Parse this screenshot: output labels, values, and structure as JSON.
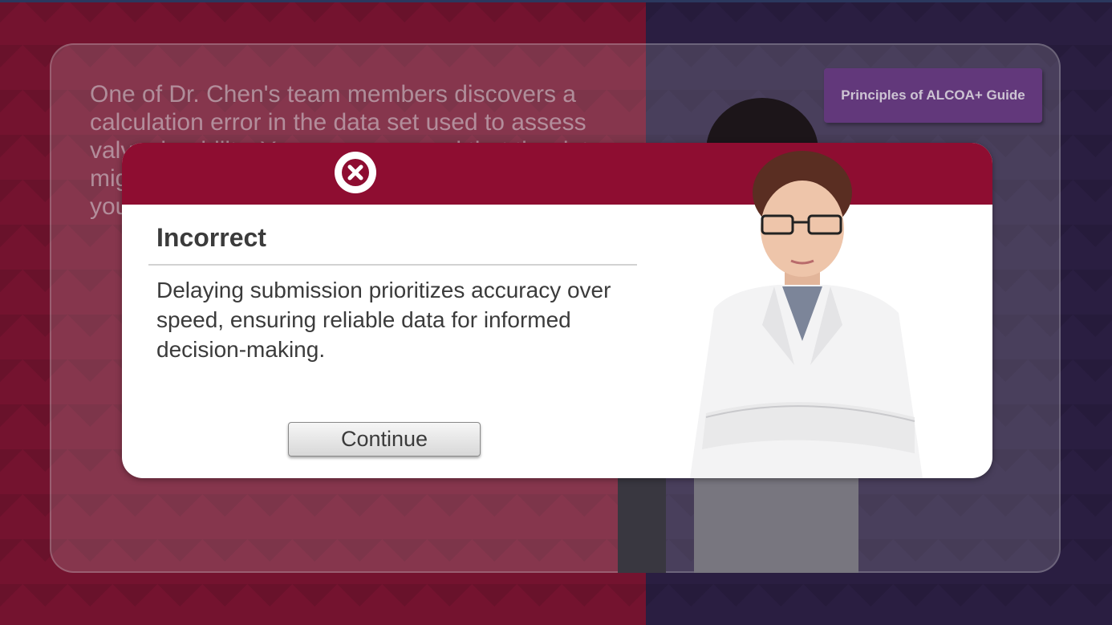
{
  "question": {
    "text": "One of Dr. Chen's team members discovers a calculation error in the data set used to assess valve durability. You are concerned that the data might affect the results. What do you do? Make your choice."
  },
  "guide_button": {
    "label": "Principles of ALCOA+ Guide"
  },
  "feedback_modal": {
    "icon": "close-x-icon",
    "title": "Incorrect",
    "message": "Delaying submission prioritizes accuracy over speed, ensuring reliable data for informed decision-making.",
    "continue_label": "Continue"
  },
  "colors": {
    "header_red": "#8e0d31",
    "background_left": "#86122f",
    "background_right": "#2b1f45",
    "guide_purple": "#6f3f8c"
  }
}
